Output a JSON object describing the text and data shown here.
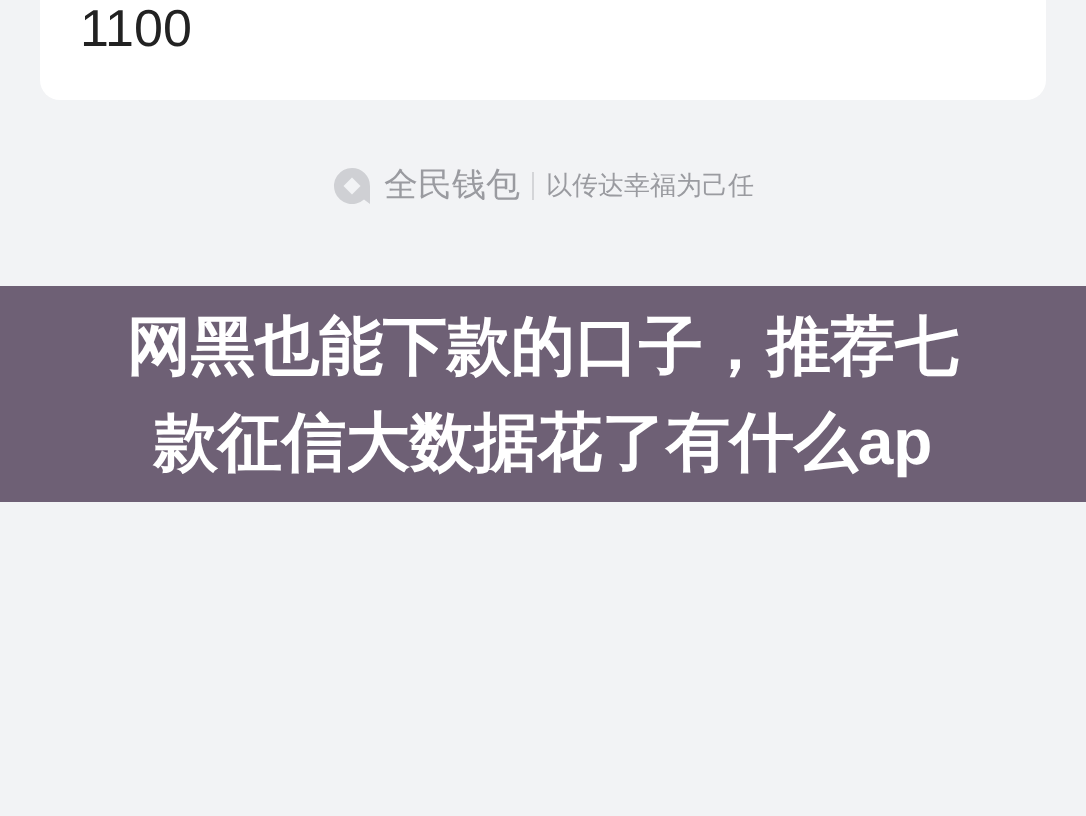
{
  "card": {
    "amount": "1100"
  },
  "footer": {
    "brand": "全民钱包",
    "slogan": "以传达幸福为己任"
  },
  "banner": {
    "title": "网黑也能下款的口子，推荐七款征信大数据花了有什么ap"
  }
}
